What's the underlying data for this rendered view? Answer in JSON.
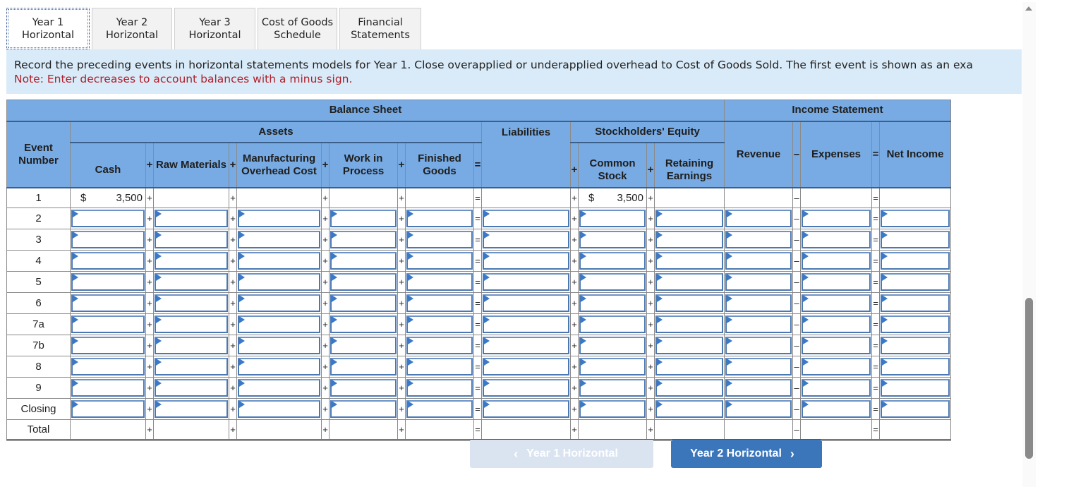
{
  "tabs": [
    {
      "line1": "Year 1",
      "line2": "Horizontal",
      "active": true
    },
    {
      "line1": "Year 2",
      "line2": "Horizontal",
      "active": false
    },
    {
      "line1": "Year 3",
      "line2": "Horizontal",
      "active": false
    },
    {
      "line1": "Cost of Goods",
      "line2": "Schedule",
      "active": false
    },
    {
      "line1": "Financial",
      "line2": "Statements",
      "active": false
    }
  ],
  "instructions": {
    "main": "Record the preceding events in horizontal statements models for Year 1. Close overapplied or underapplied overhead to Cost of Goods Sold. The first event is shown as an exa",
    "note": "Note: Enter decreases to account balances with a minus sign."
  },
  "table": {
    "group_headers": {
      "balance_sheet": "Balance Sheet",
      "income_statement": "Income Statement",
      "assets": "Assets",
      "stockholders_equity": "Stockholders' Equity"
    },
    "columns": {
      "event_number": "Event Number",
      "cash": "Cash",
      "raw_materials": "Raw Materials",
      "mfg_overhead": "Manufacturing Overhead Cost",
      "work_in_process": "Work in Process",
      "finished_goods": "Finished Goods",
      "liabilities": "Liabilities",
      "common_stock": "Common Stock",
      "retaining_earnings": "Retaining Earnings",
      "revenue": "Revenue",
      "expenses": "Expenses",
      "net_income": "Net Income"
    },
    "operators": {
      "plus": "+",
      "equals": "=",
      "minus": "–"
    },
    "currency_symbol": "$",
    "example_row": {
      "event": "1",
      "cash": "3,500",
      "common_stock": "3,500"
    },
    "input_rows": [
      "2",
      "3",
      "4",
      "5",
      "6",
      "7a",
      "7b",
      "8",
      "9",
      "Closing"
    ],
    "total_row": {
      "label": "Total"
    }
  },
  "navigation": {
    "prev_label": "Year 1 Horizontal",
    "next_label": "Year 2 Horizontal",
    "prev_icon": "‹",
    "next_icon": "›"
  }
}
